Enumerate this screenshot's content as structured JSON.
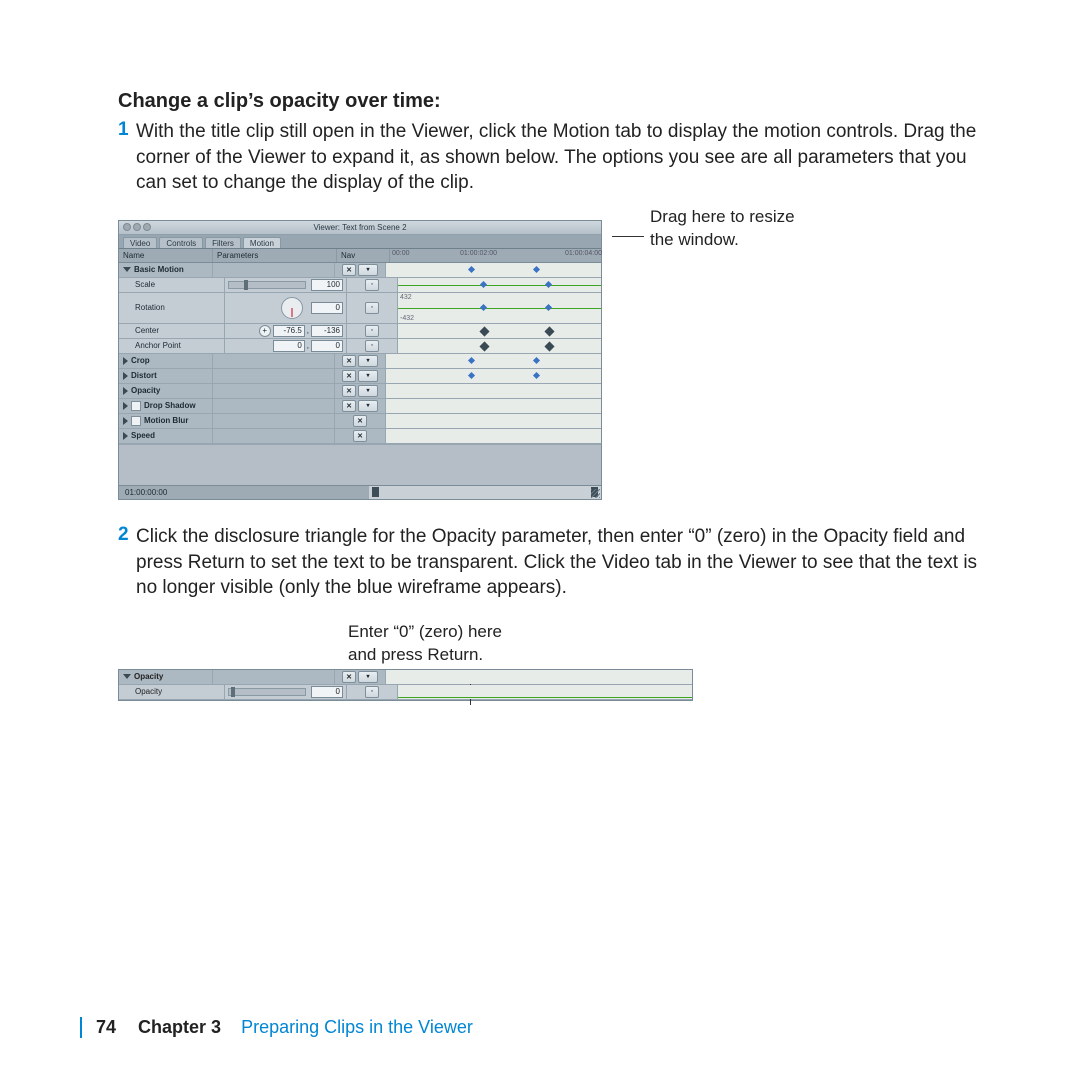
{
  "heading": "Change a clip’s opacity over time:",
  "step1": {
    "num": "1",
    "body": "With the title clip still open in the Viewer, click the Motion tab to display the motion controls. Drag the corner of the Viewer to expand it, as shown below. The options you see are all parameters that you can set to change the display of the clip."
  },
  "step2": {
    "num": "2",
    "body": "Click the disclosure triangle for the Opacity parameter, then enter “0” (zero) in the Opacity field and press Return to set the text to be transparent. Click the Video tab in the Viewer to see that the text is no longer visible (only the blue wireframe appears)."
  },
  "annot1": "Drag here to resize\nthe window.",
  "annot2": "Enter “0” (zero) here\nand press Return.",
  "viewer": {
    "title": "Viewer: Text from Scene 2",
    "tabs": [
      "Video",
      "Controls",
      "Filters",
      "Motion"
    ],
    "activeTab": 3,
    "headers": {
      "name": "Name",
      "params": "Parameters",
      "nav": "Nav"
    },
    "ruler": {
      "a": "00:00",
      "b": "01:00:02:00",
      "c": "01:00:04:00"
    },
    "rows": {
      "basic": "Basic Motion",
      "scale": {
        "label": "Scale",
        "value": "100"
      },
      "rotation": {
        "label": "Rotation",
        "value": "0"
      },
      "center": {
        "label": "Center",
        "v1": "-76.5",
        "v2": "-136"
      },
      "anchor": {
        "label": "Anchor Point",
        "v1": "0",
        "v2": "0"
      },
      "crop": "Crop",
      "distort": "Distort",
      "opacity": "Opacity",
      "dropshadow": "Drop Shadow",
      "motionblur": "Motion Blur",
      "speed": "Speed"
    },
    "rotationTicks": {
      "top": "432",
      "bot": "-432"
    },
    "timecode": "01:00:00:00"
  },
  "viewer2": {
    "opacitySection": "Opacity",
    "opacityLabel": "Opacity",
    "opacityValue": "0"
  },
  "footer": {
    "page": "74",
    "chapterLabel": "Chapter 3",
    "chapterTitle": "Preparing Clips in the Viewer"
  }
}
